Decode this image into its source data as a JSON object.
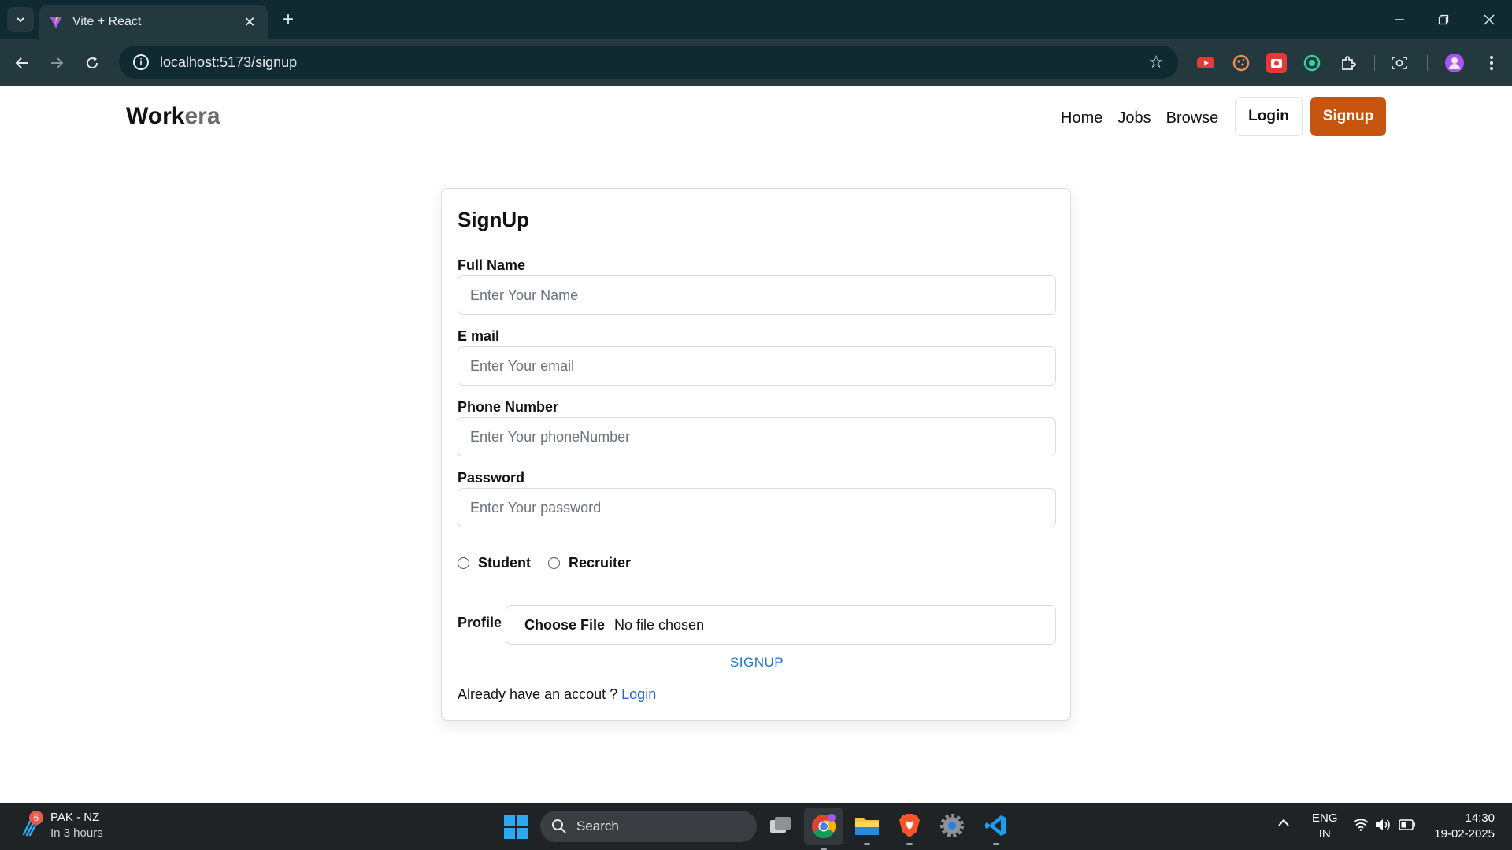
{
  "browser": {
    "tab_title": "Vite + React",
    "url": "localhost:5173/signup",
    "colors": {
      "tabbar": "#0f2a30",
      "toolbar": "#23393e"
    }
  },
  "navbar": {
    "brand_main": "Work",
    "brand_accent": "era",
    "links": [
      "Home",
      "Jobs",
      "Browse"
    ],
    "login_label": "Login",
    "signup_label": "Signup",
    "signup_color": "#c6560f"
  },
  "form": {
    "title": "SignUp",
    "fields": [
      {
        "label": "Full Name",
        "placeholder": "Enter Your Name",
        "value": ""
      },
      {
        "label": "E mail",
        "placeholder": "Enter Your email",
        "value": ""
      },
      {
        "label": "Phone Number",
        "placeholder": "Enter Your phoneNumber",
        "value": ""
      },
      {
        "label": "Password",
        "placeholder": "Enter Your password",
        "value": ""
      }
    ],
    "roles": [
      "Student",
      "Recruiter"
    ],
    "profile_label": "Profile",
    "file_button": "Choose File",
    "file_status": "No file chosen",
    "submit_label": "SIGNUP",
    "login_prompt": "Already have an accout ?",
    "login_link": "Login"
  },
  "taskbar": {
    "weather_title": "PAK - NZ",
    "weather_sub": "In 3 hours",
    "weather_badge": "6",
    "search_label": "Search",
    "lang_top": "ENG",
    "lang_bottom": "IN",
    "time": "14:30",
    "date": "19-02-2025",
    "apps": [
      "task-view-icon",
      "chrome-icon",
      "file-explorer-icon",
      "brave-icon",
      "settings-icon",
      "vscode-icon"
    ]
  }
}
